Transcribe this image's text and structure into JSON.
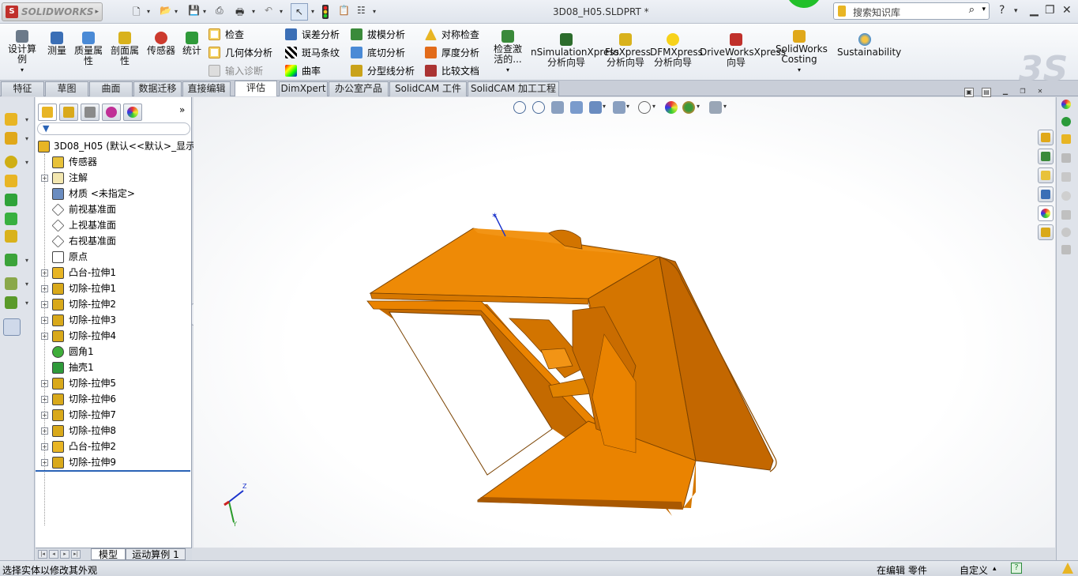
{
  "app": {
    "logo_text": "SOLIDWORKS",
    "document_title": "3D08_H05.SLDPRT *",
    "search_placeholder": "搜索知识库",
    "help_label": "?"
  },
  "ribbon": {
    "design_study": "设计算例",
    "measure": "测量",
    "mass_properties": "质量属性",
    "section_properties": "剖面属性",
    "sensors": "传感器",
    "statistics": "统计",
    "check": "检查",
    "geometry_analysis": "几何体分析",
    "import_diagnostics": "输入诊断",
    "deviation_analysis": "误差分析",
    "zebra_stripes": "斑马条纹",
    "curvature": "曲率",
    "draft_analysis": "拔模分析",
    "undercut_analysis": "底切分析",
    "parting_line_analysis": "分型线分析",
    "symmetry_check": "对称检查",
    "thickness_analysis": "厚度分析",
    "compare_documents": "比较文档",
    "check_active": "检查激活的...",
    "nsimulation": "nSimulationXpress 分析向导",
    "floxpress": "FloXpress 分析向导",
    "dfmxpress": "DFMXpress 分析向导",
    "driveworks": "DriveWorksXpress 向导",
    "costing": "SolidWorks Costing",
    "sustainability": "Sustainability"
  },
  "tabs": [
    {
      "label": "特征",
      "active": false
    },
    {
      "label": "草图",
      "active": false
    },
    {
      "label": "曲面",
      "active": false
    },
    {
      "label": "数据迁移",
      "active": false
    },
    {
      "label": "直接编辑",
      "active": false
    },
    {
      "label": "评估",
      "active": true
    },
    {
      "label": "DimXpert",
      "active": false
    },
    {
      "label": "办公室产品",
      "active": false
    },
    {
      "label": "SolidCAM 工件",
      "active": false
    },
    {
      "label": "SolidCAM 加工工程",
      "active": false
    }
  ],
  "feature_tree": {
    "root": "3D08_H05  (默认<<默认>_显示",
    "items": [
      {
        "label": "传感器",
        "expandable": false,
        "icon": "sensor-icon"
      },
      {
        "label": "注解",
        "expandable": true,
        "icon": "annotation-icon"
      },
      {
        "label": "材质 <未指定>",
        "expandable": false,
        "icon": "material-icon"
      },
      {
        "label": "前视基准面",
        "expandable": false,
        "icon": "plane-icon"
      },
      {
        "label": "上视基准面",
        "expandable": false,
        "icon": "plane-icon"
      },
      {
        "label": "右视基准面",
        "expandable": false,
        "icon": "plane-icon"
      },
      {
        "label": "原点",
        "expandable": false,
        "icon": "origin-icon"
      },
      {
        "label": "凸台-拉伸1",
        "expandable": true,
        "icon": "boss-extrude-icon"
      },
      {
        "label": "切除-拉伸1",
        "expandable": true,
        "icon": "cut-extrude-icon"
      },
      {
        "label": "切除-拉伸2",
        "expandable": true,
        "icon": "cut-extrude-icon"
      },
      {
        "label": "切除-拉伸3",
        "expandable": true,
        "icon": "cut-extrude-icon"
      },
      {
        "label": "切除-拉伸4",
        "expandable": true,
        "icon": "cut-extrude-icon"
      },
      {
        "label": "圆角1",
        "expandable": false,
        "icon": "fillet-icon"
      },
      {
        "label": "抽壳1",
        "expandable": false,
        "icon": "shell-icon"
      },
      {
        "label": "切除-拉伸5",
        "expandable": true,
        "icon": "cut-extrude-icon"
      },
      {
        "label": "切除-拉伸6",
        "expandable": true,
        "icon": "cut-extrude-icon"
      },
      {
        "label": "切除-拉伸7",
        "expandable": true,
        "icon": "cut-extrude-icon"
      },
      {
        "label": "切除-拉伸8",
        "expandable": true,
        "icon": "cut-extrude-icon"
      },
      {
        "label": "凸台-拉伸2",
        "expandable": true,
        "icon": "boss-extrude-icon"
      },
      {
        "label": "切除-拉伸9",
        "expandable": true,
        "icon": "cut-extrude-icon"
      }
    ]
  },
  "bottom_tabs": {
    "model": "模型",
    "motion_study": "运动算例 1"
  },
  "triad": {
    "z_label": "Z",
    "y_label": "Y"
  },
  "status_bar": {
    "message": "选择实体以修改其外观",
    "editing": "在编辑 零件",
    "units": "自定义"
  },
  "colors": {
    "part_orange": "#ea8300",
    "part_shadow": "#b75f00",
    "active_tab_bg": "#ffffff",
    "brand_red": "#c0302b"
  }
}
